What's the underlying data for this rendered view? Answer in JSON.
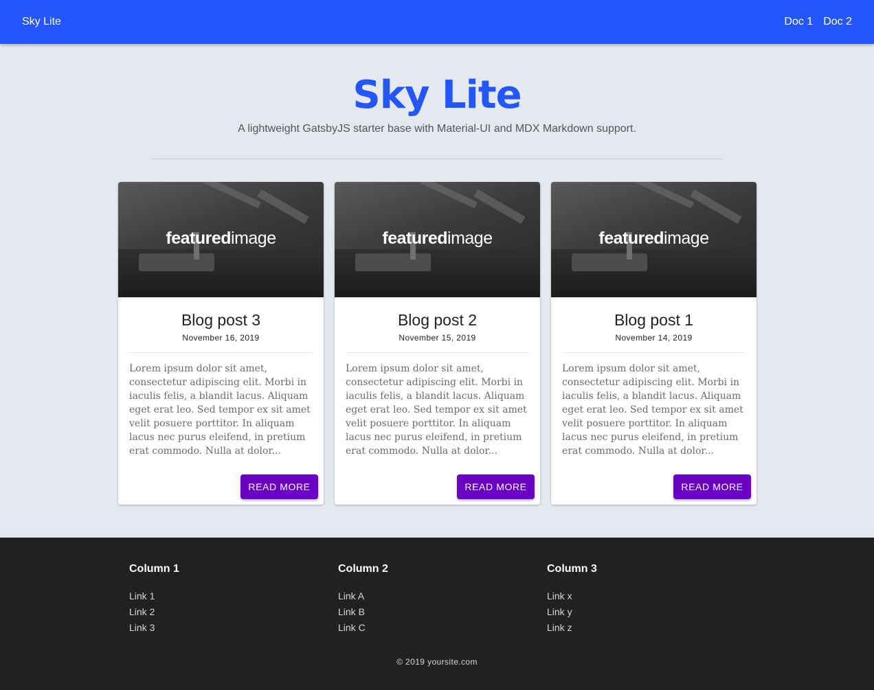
{
  "header": {
    "brand": "Sky Lite",
    "nav": [
      "Doc 1",
      "Doc 2"
    ]
  },
  "hero": {
    "title": "Sky Lite",
    "subtitle": "A lightweight GatsbyJS starter base with Material-UI and MDX Markdown support."
  },
  "posts": [
    {
      "image_text_bold": "featured",
      "image_text_light": "image",
      "title": "Blog post 3",
      "date": "November 16, 2019",
      "excerpt": "Lorem ipsum dolor sit amet, consectetur adipiscing elit. Morbi in iaculis felis, a blandit lacus. Aliquam eget erat leo. Sed tempor ex sit amet velit posuere porttitor. In aliquam lacus nec purus eleifend, in pretium erat commodo. Nulla at dolor...",
      "button": "READ MORE"
    },
    {
      "image_text_bold": "featured",
      "image_text_light": "image",
      "title": "Blog post 2",
      "date": "November 15, 2019",
      "excerpt": "Lorem ipsum dolor sit amet, consectetur adipiscing elit. Morbi in iaculis felis, a blandit lacus. Aliquam eget erat leo. Sed tempor ex sit amet velit posuere porttitor. In aliquam lacus nec purus eleifend, in pretium erat commodo. Nulla at dolor...",
      "button": "READ MORE"
    },
    {
      "image_text_bold": "featured",
      "image_text_light": "image",
      "title": "Blog post 1",
      "date": "November 14, 2019",
      "excerpt": "Lorem ipsum dolor sit amet, consectetur adipiscing elit. Morbi in iaculis felis, a blandit lacus. Aliquam eget erat leo. Sed tempor ex sit amet velit posuere porttitor. In aliquam lacus nec purus eleifend, in pretium erat commodo. Nulla at dolor...",
      "button": "READ MORE"
    }
  ],
  "footer": {
    "columns": [
      {
        "heading": "Column 1",
        "links": [
          "Link 1",
          "Link 2",
          "Link 3"
        ]
      },
      {
        "heading": "Column 2",
        "links": [
          "Link A",
          "Link B",
          "Link C"
        ]
      },
      {
        "heading": "Column 3",
        "links": [
          "Link x",
          "Link y",
          "Link z"
        ]
      }
    ],
    "copyright": "© 2019 yoursite.com"
  },
  "colors": {
    "appbar": "#2356fd",
    "hero_title": "#2356fd",
    "page_background": "#e4e9f0",
    "button": "#6a00c4",
    "footer": "#212121"
  }
}
